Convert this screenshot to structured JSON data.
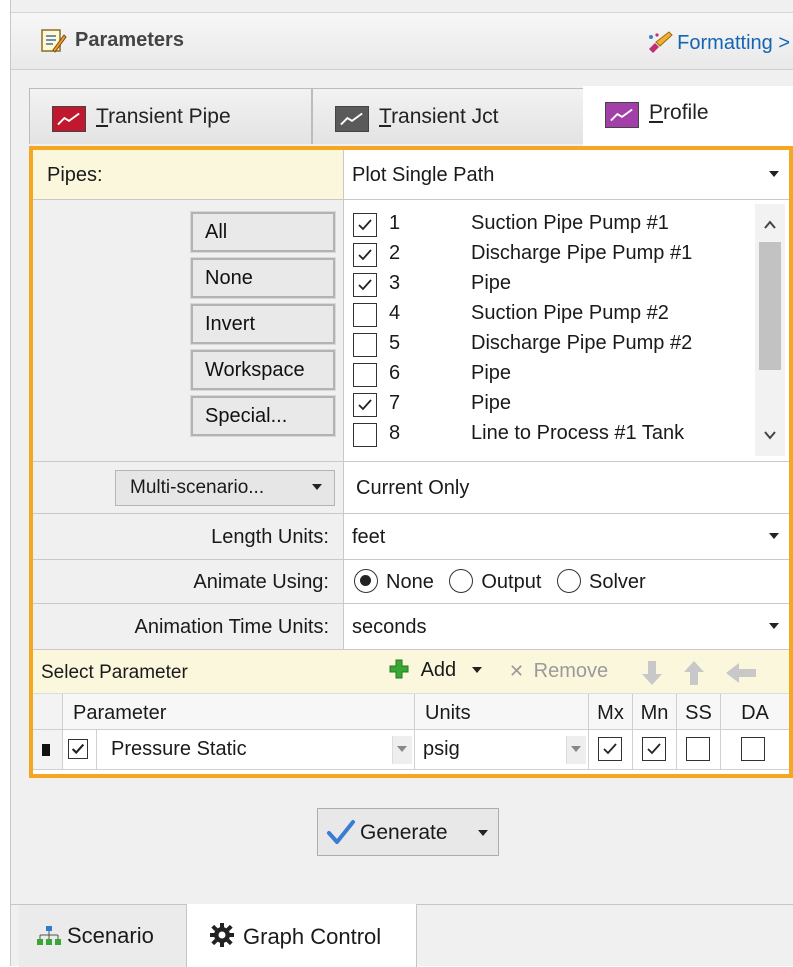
{
  "header": {
    "title": "Parameters",
    "formatting_label": "Formatting >"
  },
  "tabs": [
    {
      "label_ul": "T",
      "label_rest": "ransient Pipe",
      "icon": "line-chart-red-icon",
      "color": "#c0182e"
    },
    {
      "label_ul": "T",
      "label_rest": "ransient Jct",
      "icon": "line-chart-gray-icon",
      "color": "#5a5a5a"
    },
    {
      "label_ul": "P",
      "label_rest": "rofile",
      "icon": "line-chart-purple-icon",
      "color": "#a33fa8"
    }
  ],
  "pipes": {
    "label": "Pipes:",
    "value": "Plot Single Path"
  },
  "selection_buttons": [
    "All",
    "None",
    "Invert",
    "Workspace",
    "Special..."
  ],
  "pipe_list": [
    {
      "num": "1",
      "name": "Suction Pipe Pump #1",
      "checked": true
    },
    {
      "num": "2",
      "name": "Discharge Pipe Pump #1",
      "checked": true
    },
    {
      "num": "3",
      "name": "Pipe",
      "checked": true
    },
    {
      "num": "4",
      "name": "Suction Pipe Pump #2",
      "checked": false
    },
    {
      "num": "5",
      "name": "Discharge Pipe Pump #2",
      "checked": false
    },
    {
      "num": "6",
      "name": "Pipe",
      "checked": false
    },
    {
      "num": "7",
      "name": "Pipe",
      "checked": true
    },
    {
      "num": "8",
      "name": "Line to Process #1 Tank",
      "checked": false
    }
  ],
  "multi_scenario": {
    "button": "Multi-scenario...",
    "value": "Current Only"
  },
  "length_units": {
    "label": "Length Units:",
    "value": "feet"
  },
  "animate_using": {
    "label": "Animate Using:",
    "options": [
      "None",
      "Output",
      "Solver"
    ],
    "selected": "None"
  },
  "animation_time_units": {
    "label": "Animation Time Units:",
    "value": "seconds"
  },
  "select_parameter": {
    "label": "Select Parameter",
    "add": "Add",
    "remove": "Remove"
  },
  "param_table": {
    "headers": {
      "parameter": "Parameter",
      "units": "Units",
      "mx": "Mx",
      "mn": "Mn",
      "ss": "SS",
      "da": "DA"
    },
    "rows": [
      {
        "parameter": "Pressure Static",
        "units": "psig",
        "enabled": true,
        "mx": true,
        "mn": true,
        "ss": false,
        "da": false
      }
    ]
  },
  "generate_label": "Generate",
  "bottom_tabs": [
    {
      "label": "Scenario",
      "icon": "scenario-tree-icon"
    },
    {
      "label": "Graph Control",
      "icon": "gear-icon"
    }
  ],
  "colors": {
    "accent_border": "#f5a623",
    "header_yellow": "#fbf7dc",
    "add_green": "#3aa635"
  }
}
